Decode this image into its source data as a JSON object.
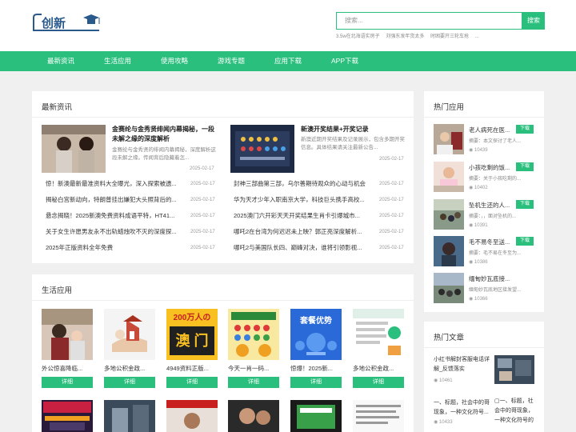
{
  "logo": {
    "text": "创新"
  },
  "search": {
    "placeholder": "搜索...",
    "button": "搜索"
  },
  "hot_searches": [
    "3.5w在北海语实房子",
    "刘强东发年货太多",
    "时困要开三轮车抢",
    "..."
  ],
  "nav": [
    "最新资讯",
    "生活应用",
    "使用攻略",
    "游戏专题",
    "应用下载",
    "APP下载"
  ],
  "latest": {
    "title": "最新资讯",
    "featured": [
      {
        "title": "金赛纶与金秀贤绯闻内幕揭秘，一段未解之缘的深度解析",
        "desc": "金赛纶与金秀贤的绯闻内幕揭秘，深度解析这段未解之缘。传闻背后隐藏着怎...",
        "date": "2025-02-17"
      },
      {
        "title": "新澳开奖结果+开奖记录",
        "desc": "新澳近期开奖结果及记录展示，包含多期开奖信息。具体结果请关注最新公告...",
        "date": "2025-02-17"
      }
    ],
    "left_list": [
      {
        "title": "惊！新澳最新最准资料大全曝光，深入探索被遗...",
        "date": "2025-02-17"
      },
      {
        "title": "揭秘白宫新动向，特朗普挂出嫌犯大头照背后的...",
        "date": "2025-02-17"
      },
      {
        "title": "悬念揭晓！2025新澳免费资料成语平特，HT41...",
        "date": "2025-02-17"
      },
      {
        "title": "关于女生许愿男友永不出轨蜡烛吹不灭的深度探...",
        "date": "2025-02-17"
      },
      {
        "title": "2025年正版资料全年免费",
        "date": "2025-02-17"
      }
    ],
    "right_list": [
      {
        "title": "封神三部曲第三部，乌尔善期待观众的心动与机会",
        "date": "2025-02-17"
      },
      {
        "title": "华为天才少年入职南京大学，科技巨头携手高校...",
        "date": "2025-02-17"
      },
      {
        "title": "2025澳门六开彩天天开奖结果生肖卡引爆城市...",
        "date": "2025-02-17"
      },
      {
        "title": "哪吒2在台湾为何迟迟未上映？郭正亮深度解析...",
        "date": "2025-02-17"
      },
      {
        "title": "哪吒2与美国队长四、巅峰对决，谁将引领影视...",
        "date": "2025-02-17"
      }
    ]
  },
  "life_apps": {
    "title": "生活应用",
    "items": [
      {
        "name": "外公惊喜降临...",
        "button": "详细"
      },
      {
        "name": "多地公积金政...",
        "button": "详细"
      },
      {
        "name": "4949资料正版...",
        "button": "详细"
      },
      {
        "name": "今天一肖一码...",
        "button": "详细"
      },
      {
        "name": "惊爆！2025新...",
        "button": "详细"
      },
      {
        "name": "多地公积金政...",
        "button": "详细"
      }
    ],
    "thumb_texts": [
      "200万人の",
      "澳 门",
      "套餐优势"
    ]
  },
  "hot_apps": {
    "title": "热门应用",
    "items": [
      {
        "name": "老人病死在医...",
        "button": "下载",
        "desc": "摘要：本文探讨了老人...",
        "count": "10439"
      },
      {
        "name": "小孩吃剩的饭...",
        "button": "下载",
        "desc": "摘要：关于小孩吃剩的...",
        "count": "10402"
      },
      {
        "name": "坠机生还的人...",
        "button": "下载",
        "desc": "摘要：，，面对坠机的...",
        "count": "10391"
      },
      {
        "name": "毛不易冬至送...",
        "button": "下载",
        "desc": "摘要：毛不易在冬至为...",
        "count": "10386"
      },
      {
        "name": "缅甸妙瓦底接...",
        "button": "下载",
        "desc": "缅甸妙瓦底地区接发望...",
        "count": "10366"
      }
    ]
  },
  "hot_articles": {
    "title": "热门文章",
    "items": [
      {
        "title": "小红书解封客服电话详解_反馈落实",
        "count": "10461"
      },
      {
        "title": "一、标题，社会中的哥现象，一种文化符号...",
        "count": "10433"
      }
    ],
    "side_text": "一、标题，社会中的哥现象，一种文化符号的"
  },
  "colors": {
    "accent": "#2bbf7e",
    "background": "#f0f0f0"
  }
}
